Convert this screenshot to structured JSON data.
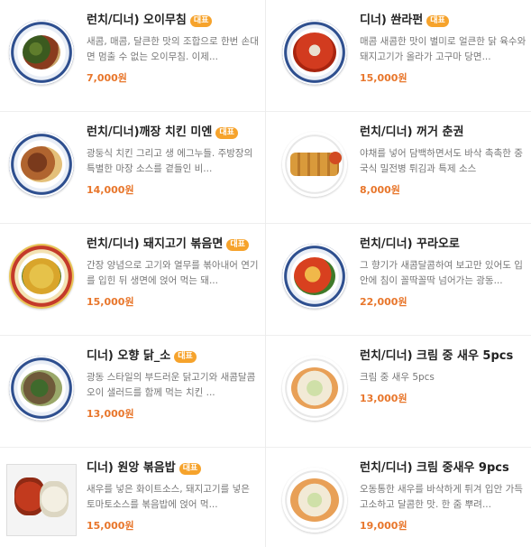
{
  "badge_label": "대표",
  "left": [
    {
      "title": "런치/디너) 오이무침",
      "badge": true,
      "desc": "새콤, 매콤, 달큰한 맛의 조합으로 한번 손대면 멈출 수 없는 오이무침. 이제...",
      "price": "7,000원"
    },
    {
      "title": "런치/디너)깨장 치킨 미엔",
      "badge": true,
      "desc": "광둥식 치킨 그리고 생 에그누들. 주방장의 특별한 마장 소스를 곁들인 비...",
      "price": "14,000원"
    },
    {
      "title": "런치/디너) 돼지고기 볶음면",
      "badge": true,
      "desc": "간장 양념으로 고기와 열무를 볶아내어 연기를 입힌 뒤 생면에 얹어 먹는 돼...",
      "price": "15,000원"
    },
    {
      "title": "디너) 오향 닭_소",
      "badge": true,
      "desc": "광동 스타일의 부드러운 닭고기와 새콤달콤 오이 샐러드를 함께 먹는 치킨 ...",
      "price": "13,000원"
    },
    {
      "title": "디너) 원앙 볶음밥",
      "badge": true,
      "desc": "새우를 넣은 화이트소스, 돼지고기를 넣은 토마토소스를 볶음밥에 얹어 먹...",
      "price": "15,000원"
    }
  ],
  "right": [
    {
      "title": "디너) 쏸라펀",
      "badge": true,
      "desc": "매콤 새콤한 맛이 별미로 얼큰한 닭 육수와 돼지고기가 올라가 고구마 당면...",
      "price": "15,000원"
    },
    {
      "title": "런치/디너) 꺼거 춘권",
      "badge": false,
      "desc": "야채를 넣어 담백하면서도 바삭 촉촉한 중국식 밀전병 튀김과 특제 소스",
      "price": "8,000원"
    },
    {
      "title": "런치/디너) 꾸라오로",
      "badge": false,
      "desc": "그 향기가 새콤달콤하여 보고만 있어도 입안에 침이 꼴딱꼴딱 넘어가는 광동...",
      "price": "22,000원"
    },
    {
      "title": "런치/디너) 크림 중 새우 5pcs",
      "badge": false,
      "desc": "크림 중 새우 5pcs",
      "price": "13,000원"
    },
    {
      "title": "런치/디너) 크림 중새우 9pcs",
      "badge": false,
      "desc": "오동통한 새우를 바삭하게 튀겨 입안 가득 고소하고 달콤한 맛. 한 줌 뿌려...",
      "price": "19,000원"
    }
  ]
}
